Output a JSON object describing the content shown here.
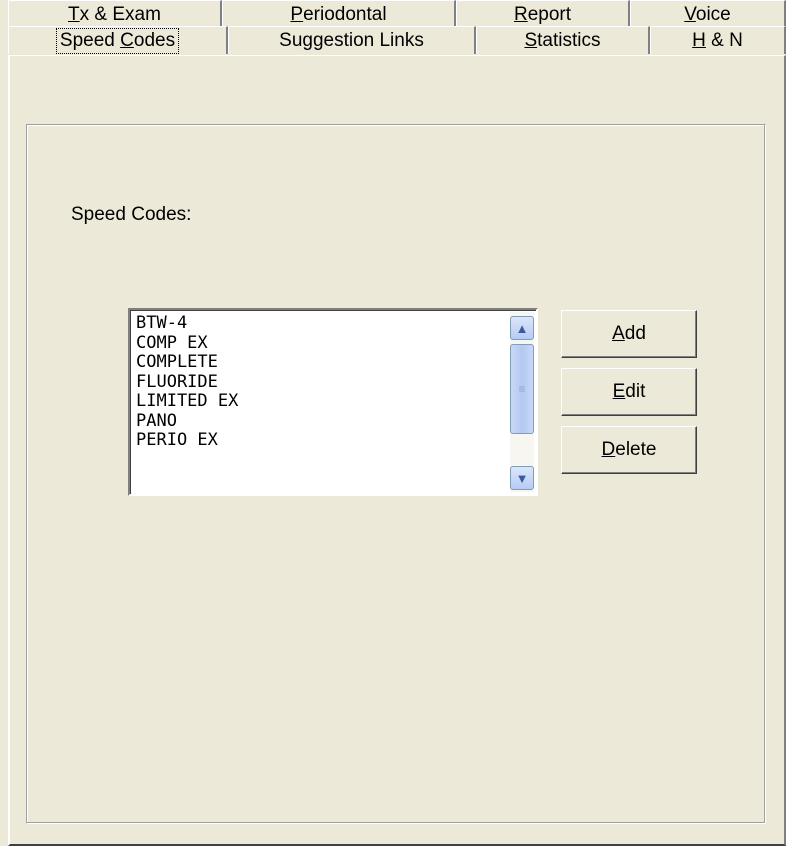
{
  "tabs_row1": [
    {
      "pre": "",
      "acc": "T",
      "post": "x & Exam"
    },
    {
      "pre": "",
      "acc": "P",
      "post": "eriodontal"
    },
    {
      "pre": "",
      "acc": "R",
      "post": "eport"
    },
    {
      "pre": "",
      "acc": "V",
      "post": "oice"
    }
  ],
  "tabs_row2": [
    {
      "pre": "Speed ",
      "acc": "C",
      "post": "odes"
    },
    {
      "pre": "Suggestion Links",
      "acc": "",
      "post": ""
    },
    {
      "pre": "",
      "acc": "S",
      "post": "tatistics"
    },
    {
      "pre": "",
      "acc": "H",
      "post": " & N"
    }
  ],
  "speed_codes": {
    "caption": "Speed Codes:",
    "items": [
      "BTW-4",
      "COMP EX",
      "COMPLETE",
      "FLUORIDE",
      "LIMITED EX",
      "PANO",
      "PERIO EX"
    ]
  },
  "buttons": {
    "add": {
      "pre": "",
      "acc": "A",
      "post": "dd"
    },
    "edit": {
      "pre": "",
      "acc": "E",
      "post": "dit"
    },
    "delete": {
      "pre": "",
      "acc": "D",
      "post": "elete"
    }
  },
  "icons": {
    "scroll_up": "▲",
    "scroll_down": "▼",
    "thumb_grip": "≡"
  }
}
